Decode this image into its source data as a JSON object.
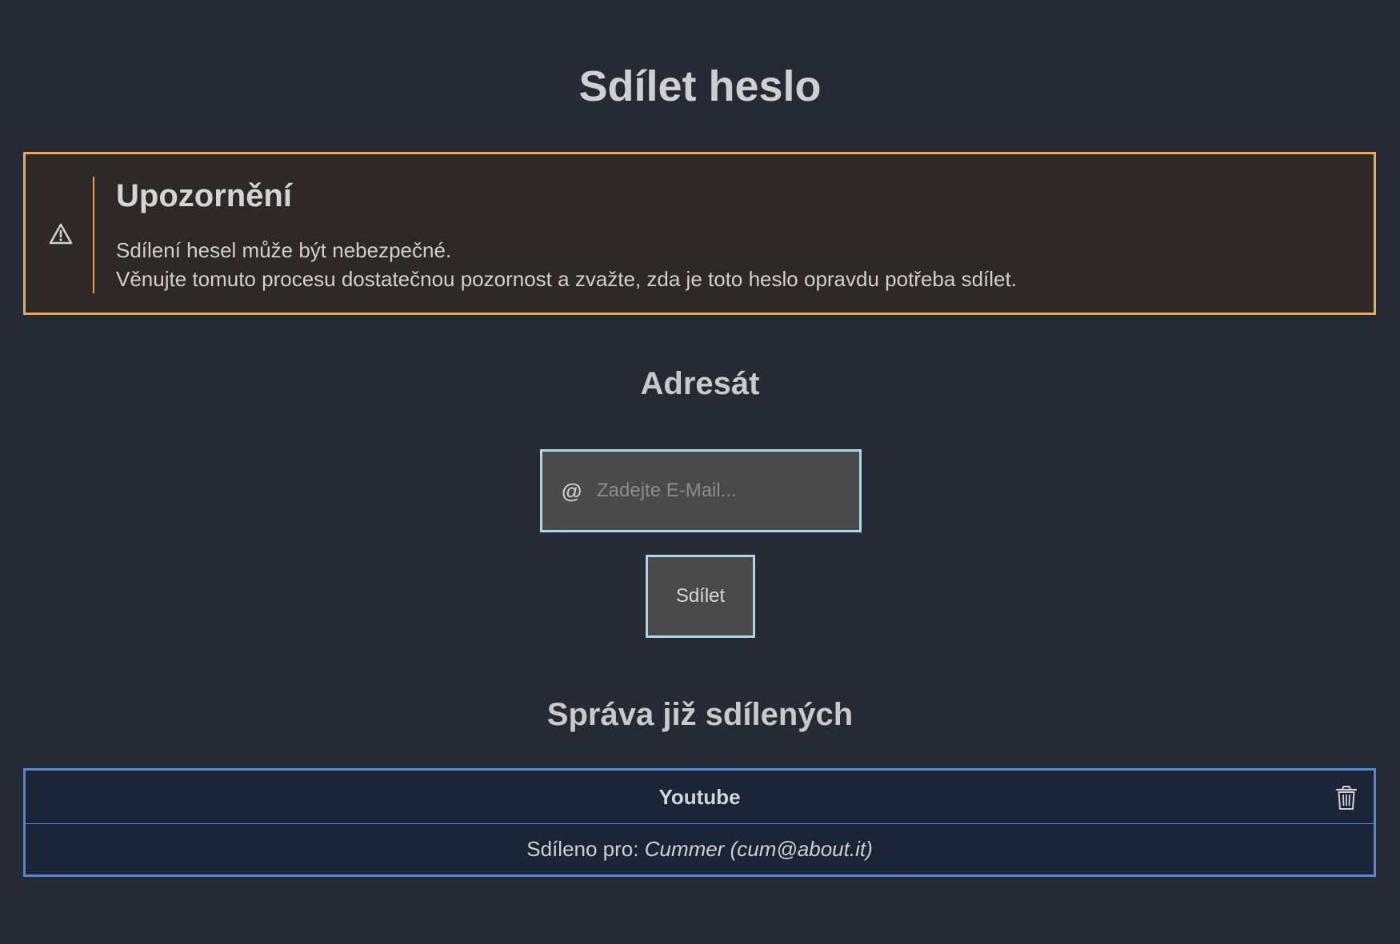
{
  "page": {
    "title": "Sdílet heslo"
  },
  "warning": {
    "title": "Upozornění",
    "line1": "Sdílení hesel může být nebezpečné.",
    "line2": "Věnujte tomuto procesu dostatečnou pozornost a zvažte, zda je toto heslo opravdu potřeba sdílet.",
    "icon": "warning-triangle-icon",
    "accent_color": "#f0a94a"
  },
  "recipient": {
    "heading": "Adresát",
    "email_icon": "@",
    "email_placeholder": "Zadejte E-Mail...",
    "email_value": "",
    "share_button_label": "Sdílet"
  },
  "manage": {
    "heading": "Správa již sdílených",
    "items": [
      {
        "name": "Youtube",
        "shared_with_label": "Sdíleno pro:",
        "shared_with_value": "Cummer (cum@about.it)",
        "delete_icon": "trash-icon"
      }
    ],
    "accent_color": "#4f86d6"
  }
}
